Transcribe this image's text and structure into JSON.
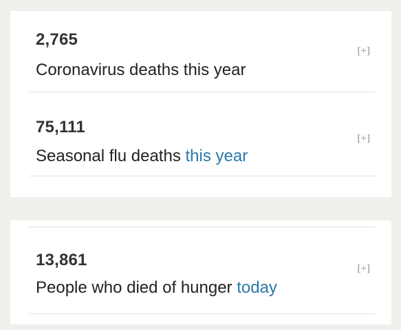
{
  "stats": [
    {
      "number": "2,765",
      "label": "Coronavirus deaths this year",
      "label_highlight": "",
      "expand": "[+]"
    },
    {
      "number": "75,111",
      "label": "Seasonal flu deaths ",
      "label_highlight": "this year",
      "expand": "[+]"
    },
    {
      "number": "13,861",
      "label": "People who died of hunger ",
      "label_highlight": "today",
      "expand": "[+]"
    }
  ],
  "colors": {
    "highlight": "#2b78a8",
    "number": "#333333",
    "background": "#f1efeb"
  }
}
